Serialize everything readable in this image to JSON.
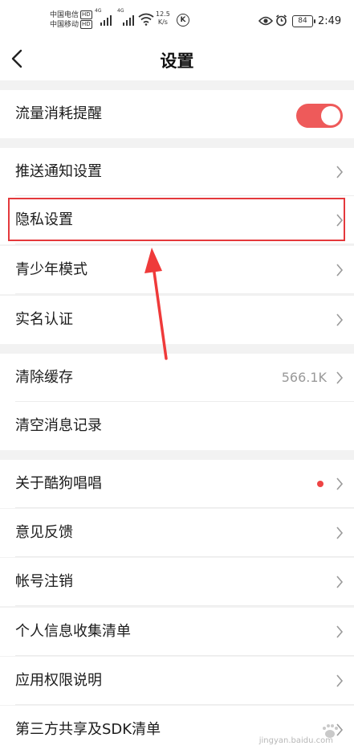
{
  "status_bar": {
    "carrier1": "中国电信",
    "carrier2": "中国移动",
    "hd": "HD",
    "network_tag": "4G",
    "speed_value": "12.5",
    "speed_unit": "K/s",
    "battery": "84",
    "time": "2:49"
  },
  "header": {
    "title": "设置"
  },
  "settings": {
    "traffic_reminder": {
      "label": "流量消耗提醒",
      "enabled": true
    },
    "push_notifications": {
      "label": "推送通知设置"
    },
    "privacy": {
      "label": "隐私设置"
    },
    "teen_mode": {
      "label": "青少年模式"
    },
    "real_name": {
      "label": "实名认证"
    },
    "clear_cache": {
      "label": "清除缓存",
      "value": "566.1K"
    },
    "clear_messages": {
      "label": "清空消息记录"
    },
    "about": {
      "label": "关于酷狗唱唱"
    },
    "feedback": {
      "label": "意见反馈"
    },
    "account_cancel": {
      "label": "帐号注销"
    },
    "personal_info": {
      "label": "个人信息收集清单"
    },
    "permissions": {
      "label": "应用权限说明"
    },
    "third_party": {
      "label": "第三方共享及SDK清单"
    }
  },
  "watermark": {
    "text": "jingyan.baidu.com"
  },
  "colors": {
    "accent": "#ee5a5a",
    "highlight": "#e4393c",
    "background": "#f2f2f2"
  }
}
